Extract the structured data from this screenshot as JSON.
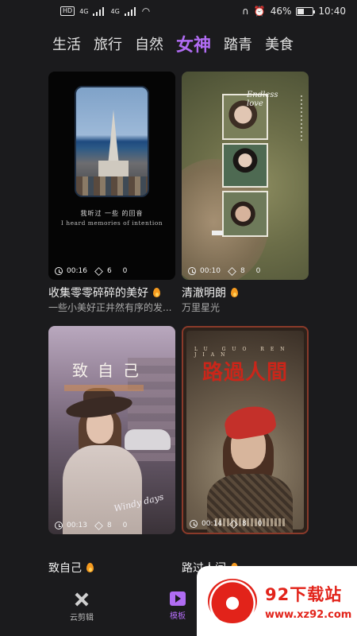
{
  "status_bar": {
    "hd_badge": "HD",
    "net1": "4G",
    "net2": "4G",
    "battery_percent": "46%",
    "battery_level": 0.46,
    "time": "10:40"
  },
  "tabs": [
    {
      "label": "生活",
      "active": false
    },
    {
      "label": "旅行",
      "active": false
    },
    {
      "label": "自然",
      "active": false
    },
    {
      "label": "女神",
      "active": true
    },
    {
      "label": "踏青",
      "active": false
    },
    {
      "label": "美食",
      "active": false
    }
  ],
  "cards": [
    {
      "title": "收集零零碎碎的美好",
      "subtitle": "一些小美好正井然有序的发...",
      "duration": "00:16",
      "layers": "6",
      "count": "0",
      "caption_cn": "我听过 一些 的回音",
      "caption_en": "I heard memories of intention"
    },
    {
      "title": "清澈明朗",
      "subtitle": "万里星光",
      "duration": "00:10",
      "layers": "8",
      "count": "0",
      "overlay_text": "Endless\nlove"
    },
    {
      "title": "致自己",
      "subtitle": "",
      "duration": "00:13",
      "layers": "8",
      "count": "0",
      "overlay_title": "致自己",
      "overlay_script": "Windy days"
    },
    {
      "title": "路过人间",
      "subtitle": "",
      "duration": "00:14",
      "layers": "8",
      "count": "0",
      "overlay_header": "LU GUO REN JIAN",
      "overlay_title": "路過人間"
    }
  ],
  "bottom_nav": [
    {
      "label": "云剪辑",
      "icon": "cloud-edit-icon",
      "active": false
    },
    {
      "label": "模板",
      "icon": "template-icon",
      "active": true
    }
  ],
  "watermark": {
    "brand": "92下载站",
    "url": "www.xz92.com"
  },
  "colors": {
    "accent": "#b06cf2",
    "background": "#1b1b1d",
    "flame": "#f59a1f",
    "watermark_red": "#e2231a"
  }
}
